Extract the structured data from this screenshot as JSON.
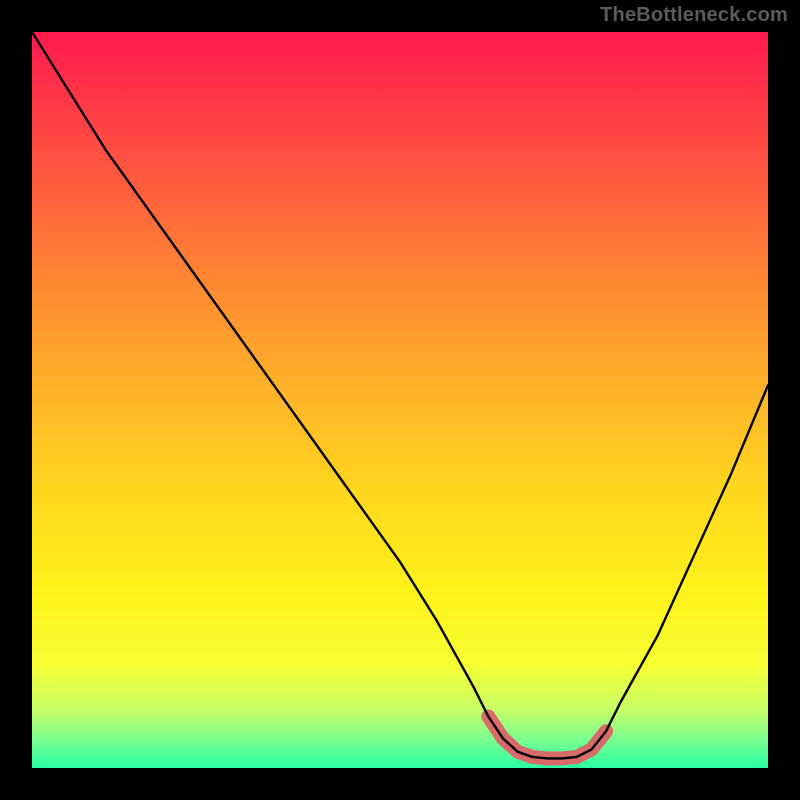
{
  "watermark": "TheBottleneck.com",
  "colors": {
    "frame_bg": "#000000",
    "watermark_text": "#5b5b5b",
    "curve_main": "#000000",
    "curve_accent": "#d86a6a",
    "gradient_top": "#ff1a4d",
    "gradient_bottom": "#2bffa3"
  },
  "chart_data": {
    "type": "line",
    "title": "",
    "xlabel": "",
    "ylabel": "",
    "xlim": [
      0,
      100
    ],
    "ylim": [
      0,
      100
    ],
    "series": [
      {
        "name": "curve",
        "x": [
          0,
          5,
          10,
          15,
          20,
          25,
          30,
          35,
          40,
          45,
          50,
          55,
          60,
          62,
          64,
          66,
          68,
          70,
          72,
          74,
          76,
          78,
          80,
          85,
          90,
          95,
          100
        ],
        "y": [
          100,
          92,
          84,
          77,
          70,
          63,
          56,
          49,
          42,
          35,
          28,
          20,
          11,
          7,
          4,
          2.2,
          1.5,
          1.3,
          1.3,
          1.5,
          2.5,
          5,
          9,
          18,
          29,
          40,
          52
        ]
      }
    ],
    "accent_range_x": [
      62,
      78
    ],
    "annotations": []
  }
}
